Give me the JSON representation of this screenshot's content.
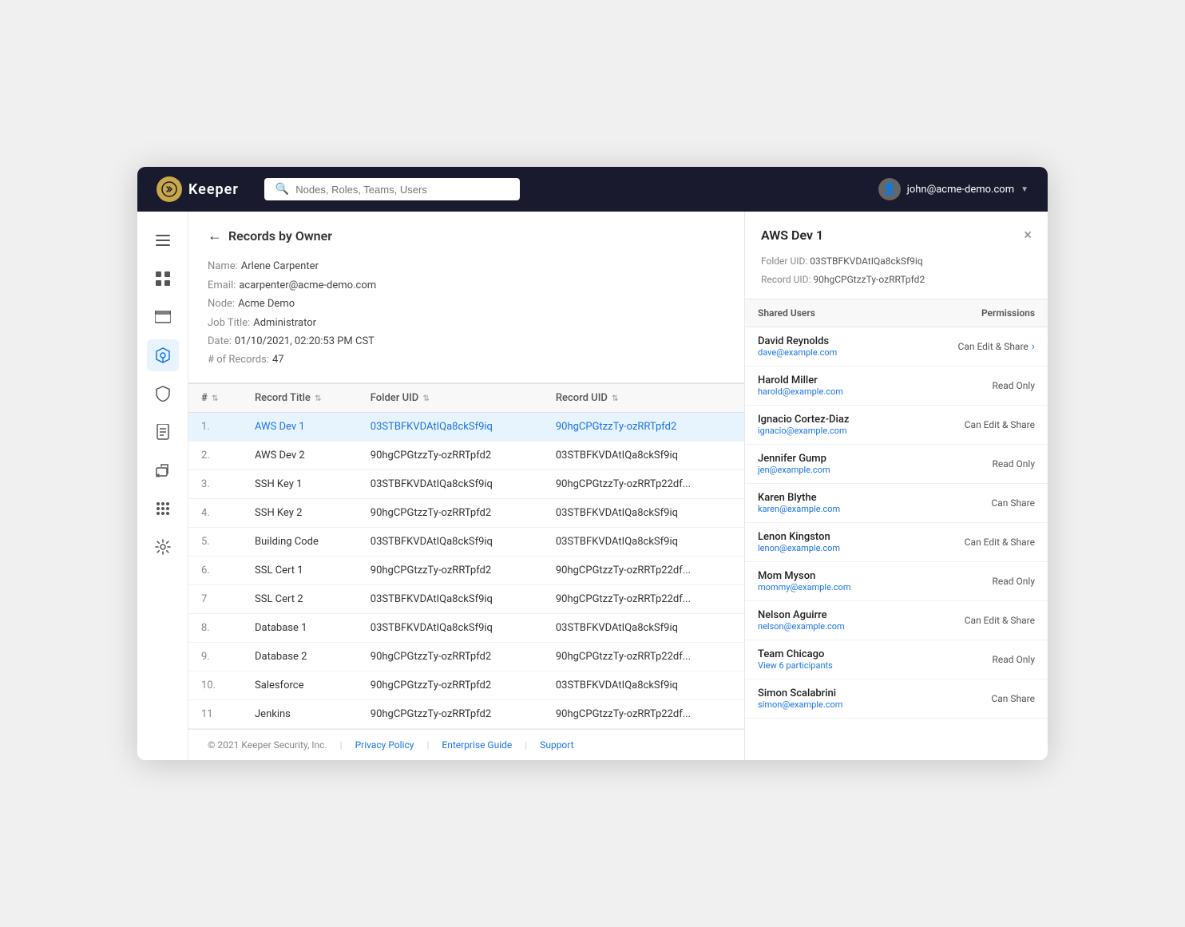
{
  "app": {
    "title": "Keeper",
    "logo_symbol": "⚙"
  },
  "header": {
    "search_placeholder": "Nodes, Roles, Teams, Users",
    "user_email": "john@acme-demo.com",
    "user_icon": "👤"
  },
  "sidebar": {
    "items": [
      {
        "id": "menu",
        "icon": "☰",
        "active": false
      },
      {
        "id": "grid",
        "icon": "⊞",
        "active": false
      },
      {
        "id": "vault",
        "icon": "▭",
        "active": false
      },
      {
        "id": "shield",
        "icon": "🛡",
        "active": true
      },
      {
        "id": "lock",
        "icon": "🔒",
        "active": false
      },
      {
        "id": "file",
        "icon": "📄",
        "active": false
      },
      {
        "id": "report",
        "icon": "📊",
        "active": false
      },
      {
        "id": "apps",
        "icon": "⋮⋮",
        "active": false
      },
      {
        "id": "settings",
        "icon": "⚙",
        "active": false
      }
    ]
  },
  "page": {
    "back_label": "←",
    "title": "Records by Owner",
    "owner": {
      "name_label": "Name:",
      "name_value": "Arlene Carpenter",
      "email_label": "Email:",
      "email_value": "acarpenter@acme-demo.com",
      "node_label": "Node:",
      "node_value": "Acme Demo",
      "job_title_label": "Job Title:",
      "job_title_value": "Administrator",
      "date_label": "Date:",
      "date_value": "01/10/2021, 02:20:53 PM CST",
      "records_label": "# of Records:",
      "records_value": "47"
    },
    "table": {
      "columns": [
        {
          "id": "num",
          "label": "#",
          "sortable": true
        },
        {
          "id": "title",
          "label": "Record Title",
          "sortable": true
        },
        {
          "id": "folder_uid",
          "label": "Folder UID",
          "sortable": true
        },
        {
          "id": "record_uid",
          "label": "Record UID",
          "sortable": true
        }
      ],
      "rows": [
        {
          "num": "1.",
          "title": "AWS Dev 1",
          "folder_uid": "03STBFKVDAtIQa8ckSf9iq",
          "record_uid": "90hgCPGtzzTy-ozRRTpfd2",
          "selected": true
        },
        {
          "num": "2.",
          "title": "AWS Dev 2",
          "folder_uid": "90hgCPGtzzTy-ozRRTpfd2",
          "record_uid": "03STBFKVDAtIQa8ckSf9iq",
          "selected": false
        },
        {
          "num": "3.",
          "title": "SSH Key 1",
          "folder_uid": "03STBFKVDAtIQa8ckSf9iq",
          "record_uid": "90hgCPGtzzTy-ozRRTp22df...",
          "selected": false
        },
        {
          "num": "4.",
          "title": "SSH Key 2",
          "folder_uid": "90hgCPGtzzTy-ozRRTpfd2",
          "record_uid": "03STBFKVDAtIQa8ckSf9iq",
          "selected": false
        },
        {
          "num": "5.",
          "title": "Building Code",
          "folder_uid": "03STBFKVDAtIQa8ckSf9iq",
          "record_uid": "03STBFKVDAtIQa8ckSf9iq",
          "selected": false
        },
        {
          "num": "6.",
          "title": "SSL Cert 1",
          "folder_uid": "90hgCPGtzzTy-ozRRTpfd2",
          "record_uid": "90hgCPGtzzTy-ozRRTp22df...",
          "selected": false
        },
        {
          "num": "7",
          "title": "SSL Cert 2",
          "folder_uid": "03STBFKVDAtIQa8ckSf9iq",
          "record_uid": "90hgCPGtzzTy-ozRRTp22df...",
          "selected": false
        },
        {
          "num": "8.",
          "title": "Database 1",
          "folder_uid": "03STBFKVDAtIQa8ckSf9iq",
          "record_uid": "03STBFKVDAtIQa8ckSf9iq",
          "selected": false
        },
        {
          "num": "9.",
          "title": "Database 2",
          "folder_uid": "90hgCPGtzzTy-ozRRTpfd2",
          "record_uid": "90hgCPGtzzTy-ozRRTp22df...",
          "selected": false
        },
        {
          "num": "10.",
          "title": "Salesforce",
          "folder_uid": "90hgCPGtzzTy-ozRRTpfd2",
          "record_uid": "03STBFKVDAtIQa8ckSf9iq",
          "selected": false
        },
        {
          "num": "11",
          "title": "Jenkins",
          "folder_uid": "90hgCPGtzzTy-ozRRTpfd2",
          "record_uid": "90hgCPGtzzTy-ozRRTp22df...",
          "selected": false
        }
      ]
    },
    "footer": {
      "copyright": "© 2021 Keeper Security, Inc.",
      "links": [
        "Privacy Policy",
        "Enterprise Guide",
        "Support"
      ]
    }
  },
  "panel": {
    "title": "AWS Dev 1",
    "close_icon": "×",
    "folder_uid_label": "Folder UID:",
    "folder_uid_value": "03STBFKVDAtIQa8ckSf9iq",
    "record_uid_label": "Record UID:",
    "record_uid_value": "90hgCPGtzzTy-ozRRTpfd2",
    "shared_users_header": "Shared Users",
    "permissions_header": "Permissions",
    "shared_users": [
      {
        "name": "David Reynolds",
        "email": "dave@example.com",
        "permission": "Can Edit & Share",
        "has_arrow": true
      },
      {
        "name": "Harold Miller",
        "email": "harold@example.com",
        "permission": "Read Only",
        "has_arrow": false
      },
      {
        "name": "Ignacio Cortez-Diaz",
        "email": "ignacio@example.com",
        "permission": "Can Edit & Share",
        "has_arrow": false
      },
      {
        "name": "Jennifer Gump",
        "email": "jen@example.com",
        "permission": "Read Only",
        "has_arrow": false
      },
      {
        "name": "Karen Blythe",
        "email": "karen@example.com",
        "permission": "Can Share",
        "has_arrow": false
      },
      {
        "name": "Lenon Kingston",
        "email": "lenon@example.com",
        "permission": "Can Edit & Share",
        "has_arrow": false
      },
      {
        "name": "Mom Myson",
        "email": "mommy@example.com",
        "permission": "Read Only",
        "has_arrow": false
      },
      {
        "name": "Nelson Aguirre",
        "email": "nelson@example.com",
        "permission": "Can Edit & Share",
        "has_arrow": false
      },
      {
        "name": "Team Chicago",
        "email": "View 6 participants",
        "permission": "Read Only",
        "has_arrow": false,
        "is_team": true
      },
      {
        "name": "Simon Scalabrini",
        "email": "simon@example.com",
        "permission": "Can Share",
        "has_arrow": false
      }
    ]
  }
}
